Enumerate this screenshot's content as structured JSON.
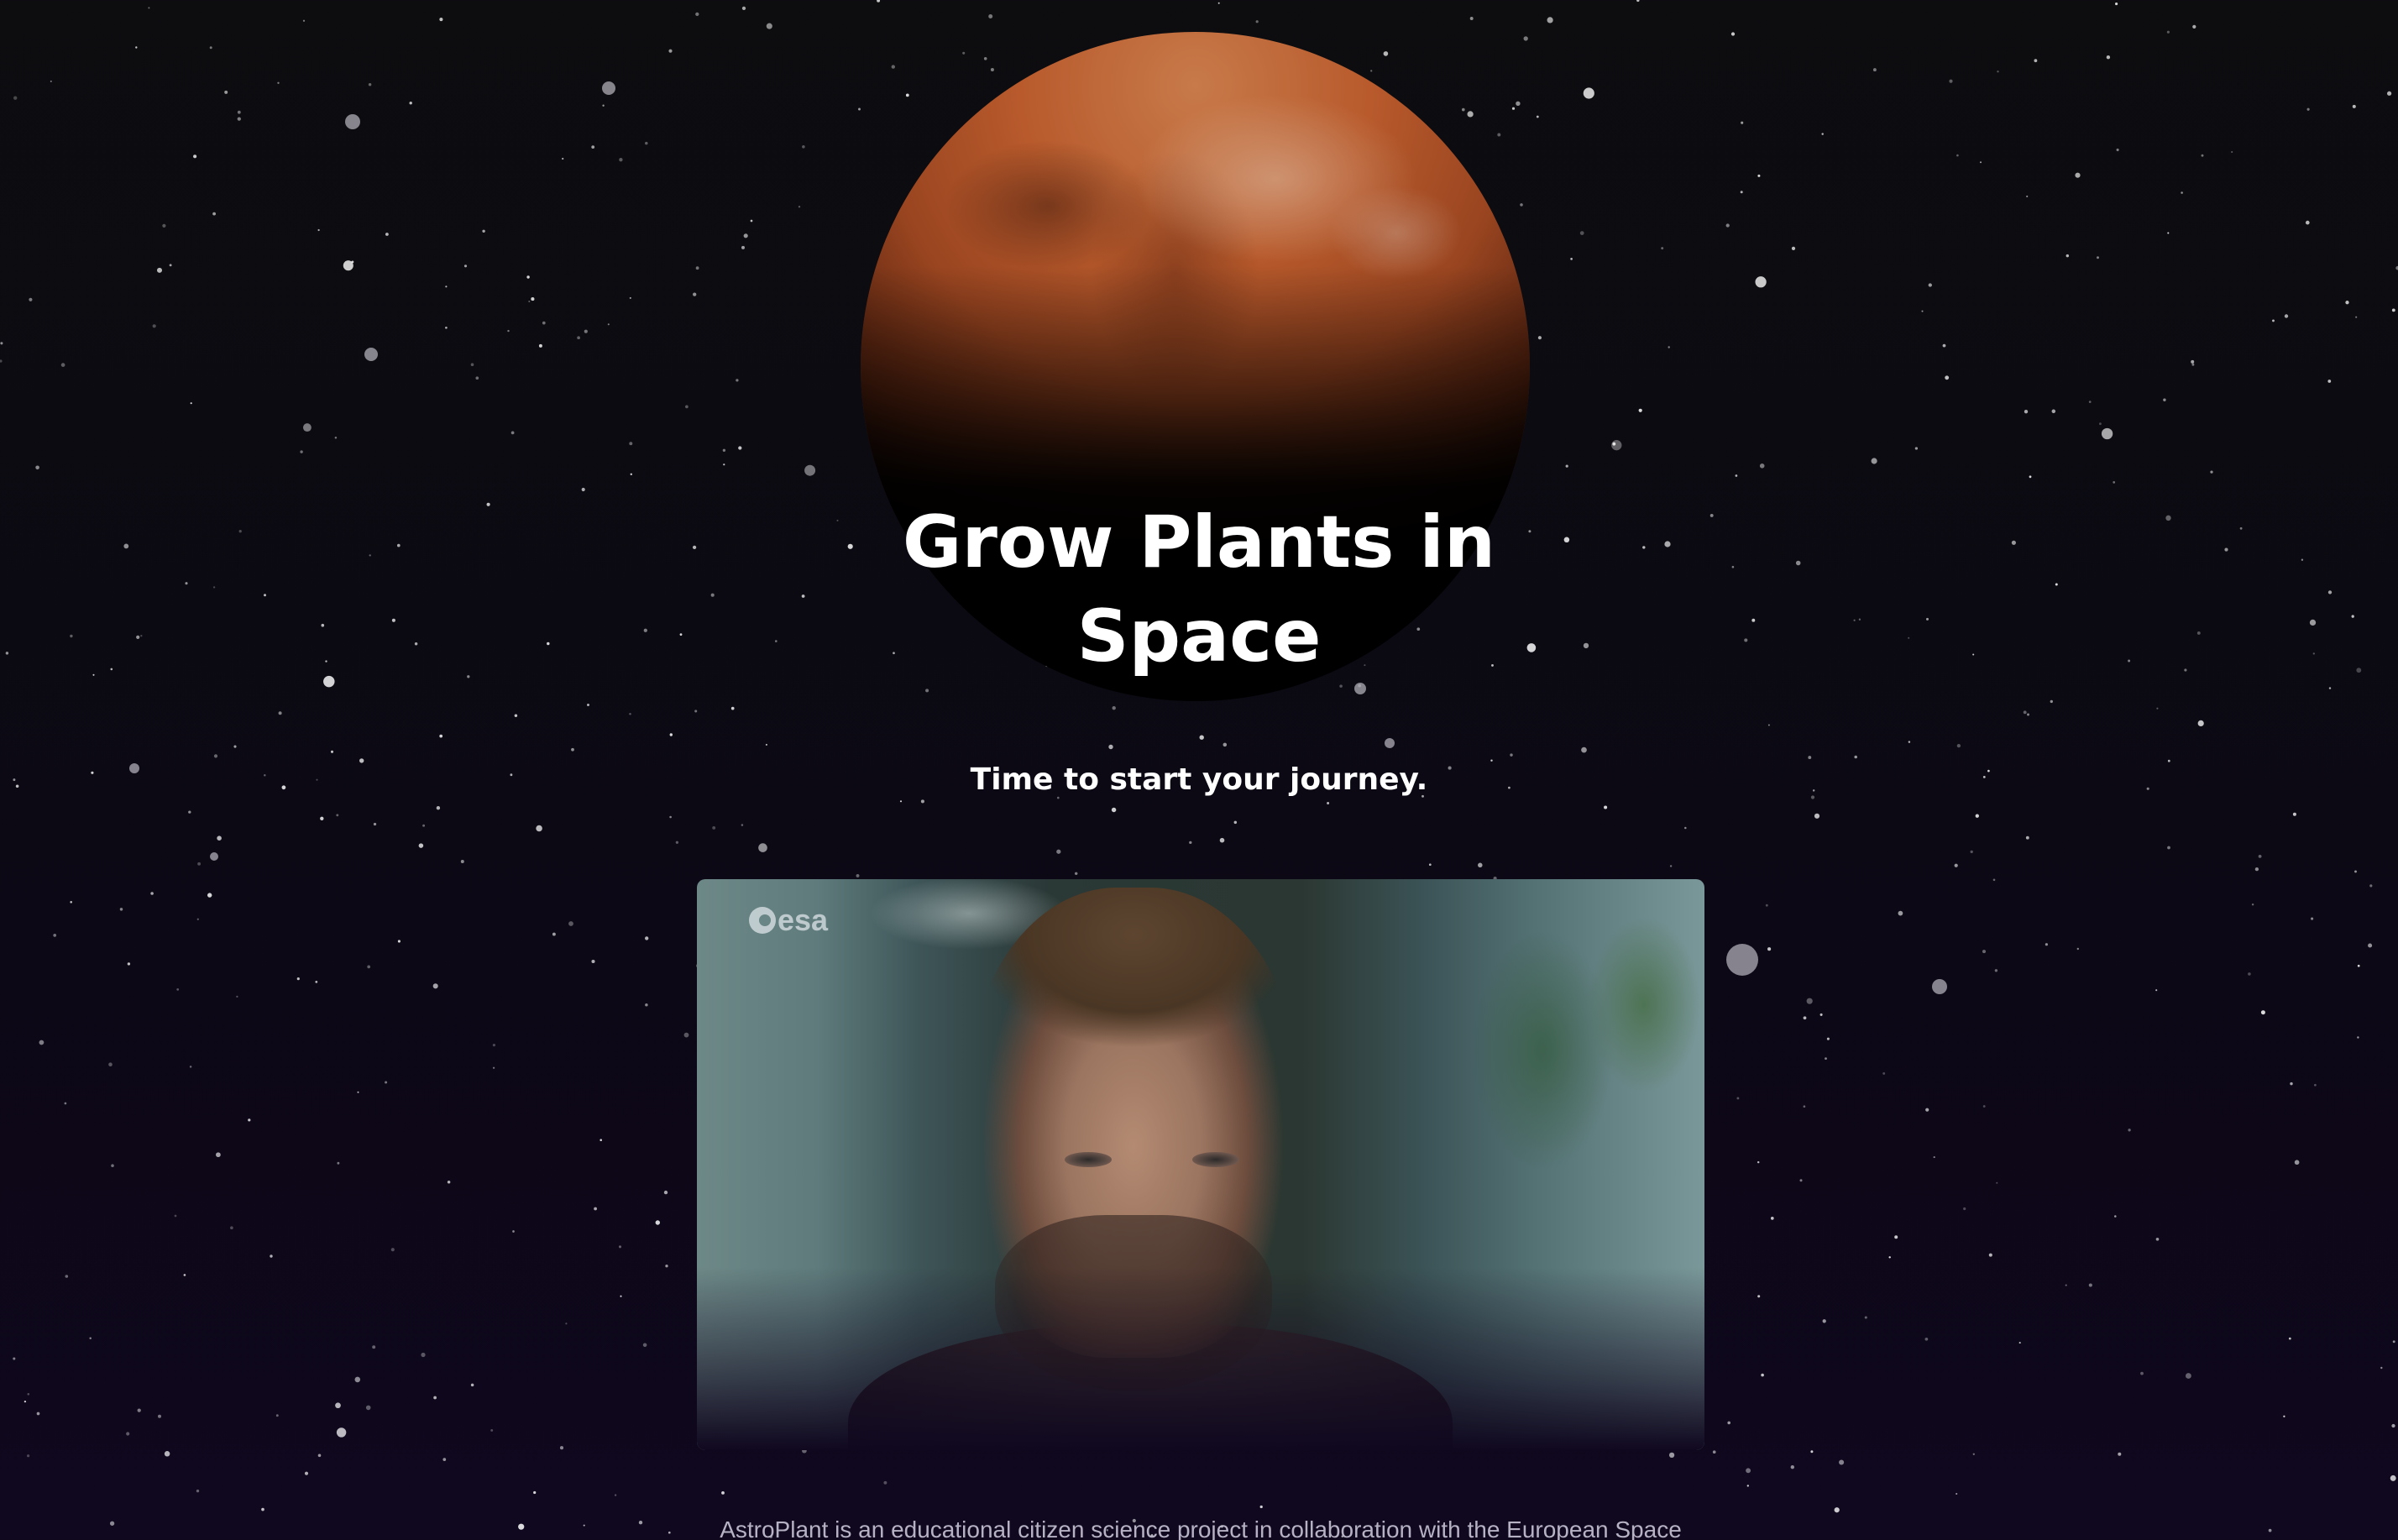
{
  "hero": {
    "title_line1": "Grow Plants in",
    "title_line2": "Space",
    "subtitle": "Time to start your journey."
  },
  "video": {
    "logo_text": "esa",
    "logo_icon": "esa-logo-icon"
  },
  "intro": {
    "description": "AstroPlant is an educational citizen science project in collaboration with the European Space"
  },
  "colors": {
    "background": "#0d0d10",
    "background_bottom": "#10081f",
    "text": "#ffffff",
    "muted_text": "#b6b2c4",
    "planet": "#b85a2c"
  }
}
